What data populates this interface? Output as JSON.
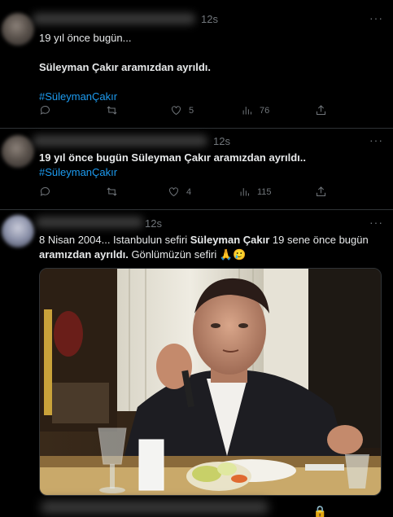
{
  "tweets": [
    {
      "time": "12s",
      "line1": "19 yıl önce bugün...",
      "line2": "Süleyman Çakır aramızdan ayrıldı.",
      "hashtag": "#SüleymanÇakır",
      "likes": "5",
      "views": "76"
    },
    {
      "time": "12s",
      "text_bold": "19 yıl önce bugün Süleyman Çakır aramızdan ayrıldı..",
      "hashtag": "#SüleymanÇakır",
      "likes": "4",
      "views": "115"
    },
    {
      "time": "12s",
      "text_a": "8 Nisan 2004... Istanbulun sefiri ",
      "text_b": "Süleyman Çakır",
      "text_c": " 19 sene önce bugün",
      "text_d": "aramızdan ayrıldı.",
      "text_e": " Gönlümüzün sefiri 🙏🥲"
    }
  ],
  "icons": {
    "more": "more-icon",
    "reply": "reply-icon",
    "retweet": "retweet-icon",
    "like": "like-icon",
    "views": "views-icon",
    "share": "share-icon"
  }
}
